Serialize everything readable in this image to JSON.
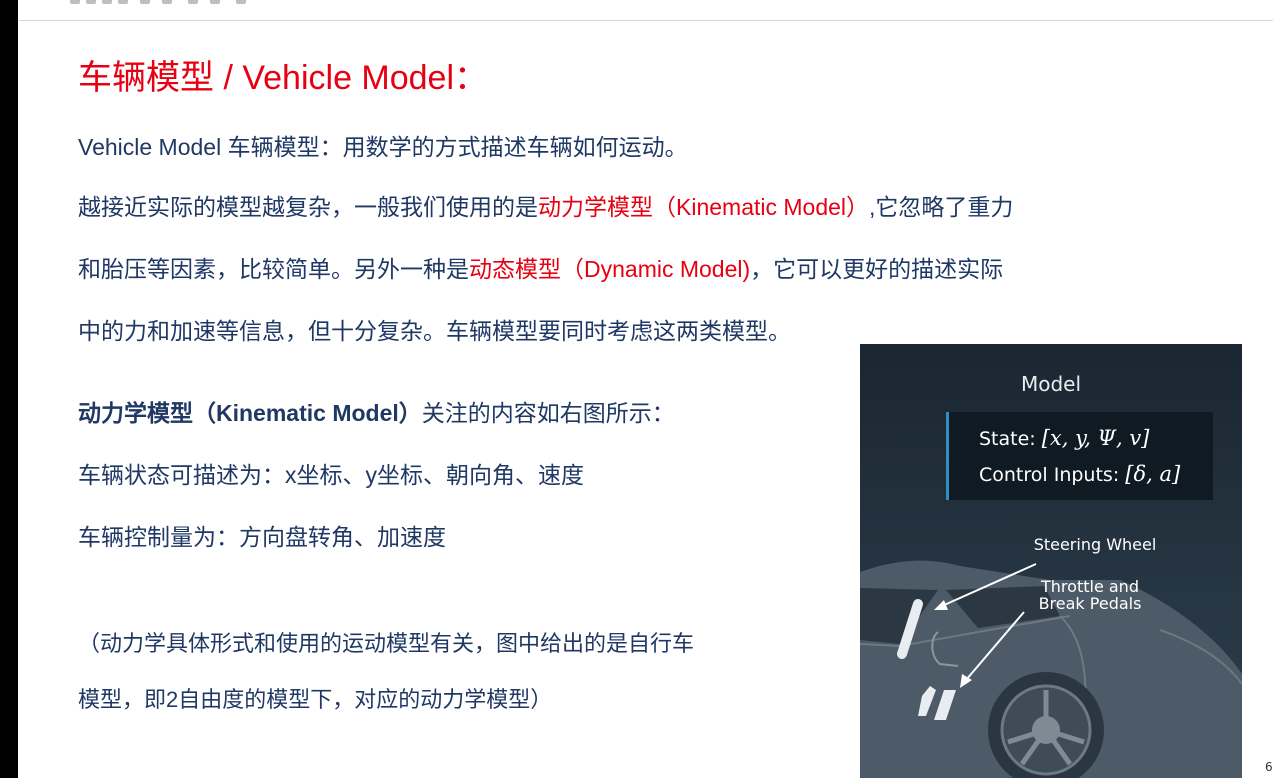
{
  "title": "车辆模型 / Vehicle Model：",
  "line1": "Vehicle Model 车辆模型：用数学的方式描述车辆如何运动。",
  "line2": {
    "a": "越接近实际的模型越复杂，一般我们使用的是",
    "red": "动力学模型（Kinematic Model）",
    "b": ",它忽略了重力"
  },
  "line3": {
    "a": "和胎压等因素，比较简单。另外一种是",
    "red": "动态模型（Dynamic Model)",
    "b": "，它可以更好的描述实际"
  },
  "line4": "中的力和加速等信息，但十分复杂。车辆模型要同时考虑这两类模型。",
  "kinematic": {
    "bold": "动力学模型（Kinematic Model）",
    "rest": "关注的内容如右图所示："
  },
  "state_desc": "车辆状态可描述为：x坐标、y坐标、朝向角、速度",
  "control_desc": "车辆控制量为：方向盘转角、加速度",
  "note1": "（动力学具体形式和使用的运动模型有关，图中给出的是自行车",
  "note2": "模型，即2自由度的模型下，对应的动力学模型）",
  "figure": {
    "title": "Model",
    "state_label": "State: ",
    "state_value": "[x, y, Ψ, v]",
    "control_label": "Control Inputs: ",
    "control_value": "[δ, a]",
    "steering_label": "Steering Wheel",
    "pedals_line1": "Throttle and",
    "pedals_line2": "Break Pedals"
  },
  "page_number": "6"
}
